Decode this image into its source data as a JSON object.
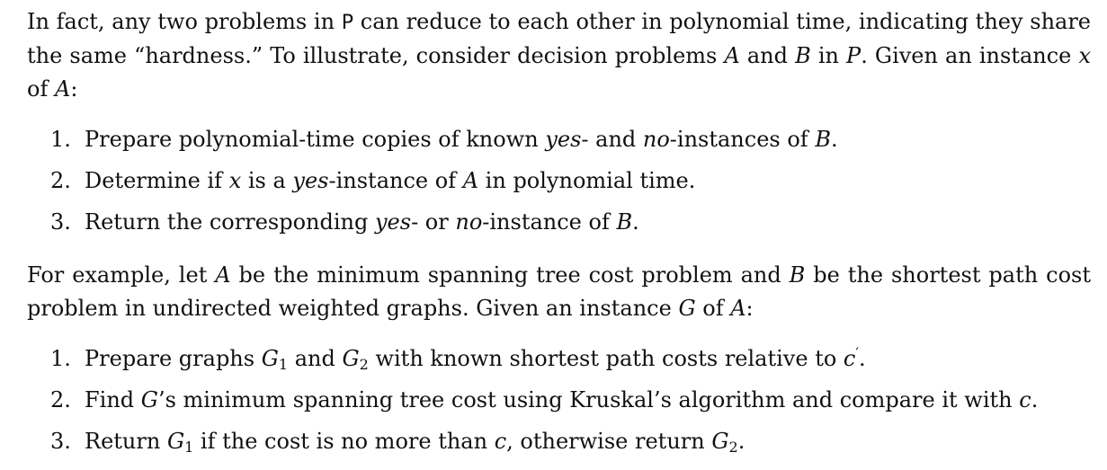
{
  "paragraph1": {
    "part1": "In fact, any two problems in ",
    "class_P_sans": "P",
    "part2": " can reduce to each other in polynomial time, indicating they share the same “hardness.” To illustrate, consider decision problems ",
    "A": "A",
    "and": " and ",
    "B": "B",
    "in": " in ",
    "class_P_cal": "P",
    "part3": ". Given an instance ",
    "x": "x",
    "of": " of ",
    "A2": "A",
    "colon": ":"
  },
  "list1": [
    {
      "num": "1.",
      "t1": "Prepare polynomial-time copies of known ",
      "yes": "yes",
      "t2": "- and ",
      "no": "no",
      "t3": "-instances of ",
      "B": "B",
      "t4": "."
    },
    {
      "num": "2.",
      "t1": "Determine if ",
      "x": "x",
      "t2": " is a ",
      "yes": "yes",
      "t3": "-instance of ",
      "A": "A",
      "t4": " in polynomial time."
    },
    {
      "num": "3.",
      "t1": "Return the corresponding ",
      "yes": "yes",
      "t2": "- or ",
      "no": "no",
      "t3": "-instance of ",
      "B": "B",
      "t4": "."
    }
  ],
  "paragraph2": {
    "t1": "For example, let ",
    "A": "A",
    "t2": " be the minimum spanning tree cost problem and ",
    "B": "B",
    "t3": " be the shortest path cost problem in undirected weighted graphs. Given an instance ",
    "G": "G",
    "t4": " of ",
    "A2": "A",
    "t5": ":"
  },
  "list2": [
    {
      "num": "1.",
      "t1": "Prepare graphs ",
      "G1": "G",
      "sub1": "1",
      "t2": " and ",
      "G2": "G",
      "sub2": "2",
      "t3": " with known shortest path costs relative to ",
      "c": "c",
      "prime": "′",
      "t4": "."
    },
    {
      "num": "2.",
      "t1": "Find ",
      "G": "G",
      "t2": "’s minimum spanning tree cost using Kruskal’s algorithm and compare it with ",
      "c": "c",
      "t3": "."
    },
    {
      "num": "3.",
      "t1": "Return ",
      "G1": "G",
      "sub1": "1",
      "t2": " if the cost is no more than ",
      "c": "c",
      "t3": ", otherwise return ",
      "G2": "G",
      "sub2": "2",
      "t4": "."
    }
  ]
}
